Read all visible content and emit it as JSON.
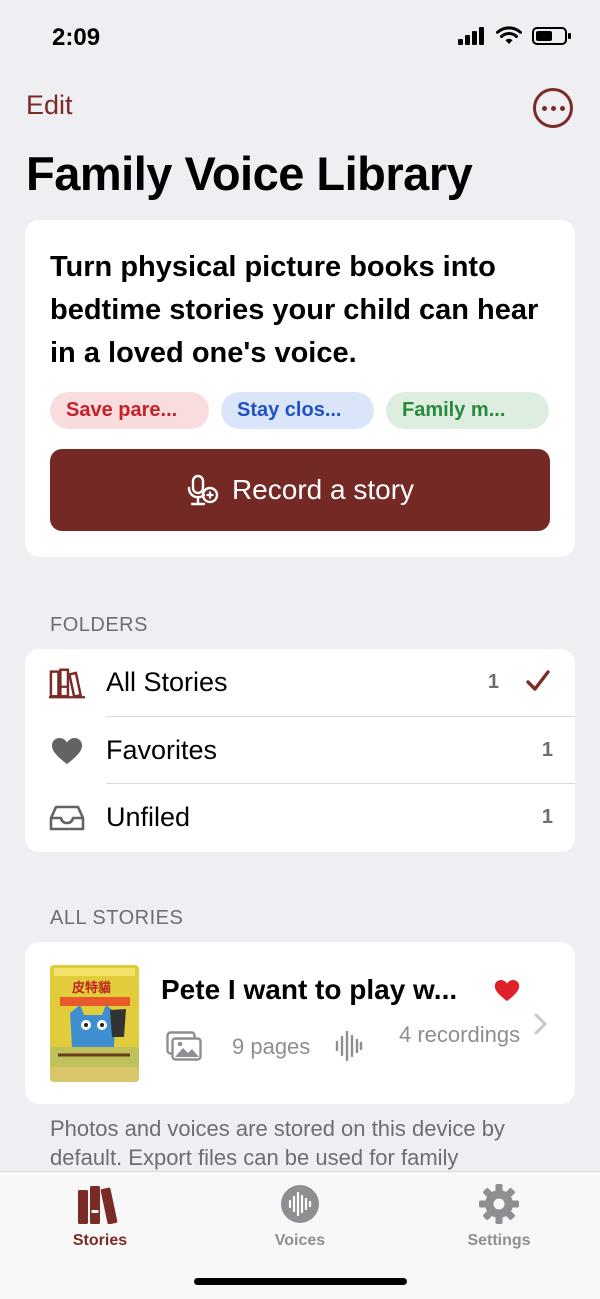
{
  "status_bar": {
    "time": "2:09"
  },
  "nav": {
    "edit_label": "Edit",
    "more_icon": "ellipsis-circle-icon"
  },
  "page": {
    "title": "Family Voice Library"
  },
  "hero": {
    "text": "Turn physical picture books into bedtime stories your child can hear in a loved one's voice.",
    "tags": [
      {
        "label": "Save pare...",
        "color": "#c8202a"
      },
      {
        "label": "Stay clos...",
        "color": "#1f52c4"
      },
      {
        "label": "Family m...",
        "color": "#2a8a3c"
      }
    ],
    "record_label": "Record a story",
    "accent": "#742924"
  },
  "folders": {
    "header": "FOLDERS",
    "items": [
      {
        "label": "All Stories",
        "count": "1",
        "selected": true,
        "icon": "books-icon"
      },
      {
        "label": "Favorites",
        "count": "1",
        "icon": "heart-icon"
      },
      {
        "label": "Unfiled",
        "count": "1",
        "icon": "tray-icon"
      }
    ]
  },
  "stories": {
    "header": "ALL STORIES",
    "items": [
      {
        "title": "Pete I want to play w...",
        "favorite": true,
        "pages": "9 pages",
        "recordings": "4 recordings",
        "cover_text": "皮特貓"
      }
    ]
  },
  "footer_note": "Photos and voices are stored on this device by default. Export files can be used for family",
  "tabs": [
    {
      "label": "Stories",
      "icon": "books-icon",
      "active": true
    },
    {
      "label": "Voices",
      "icon": "waveform-circle-icon",
      "active": false
    },
    {
      "label": "Settings",
      "icon": "gear-icon",
      "active": false
    }
  ]
}
